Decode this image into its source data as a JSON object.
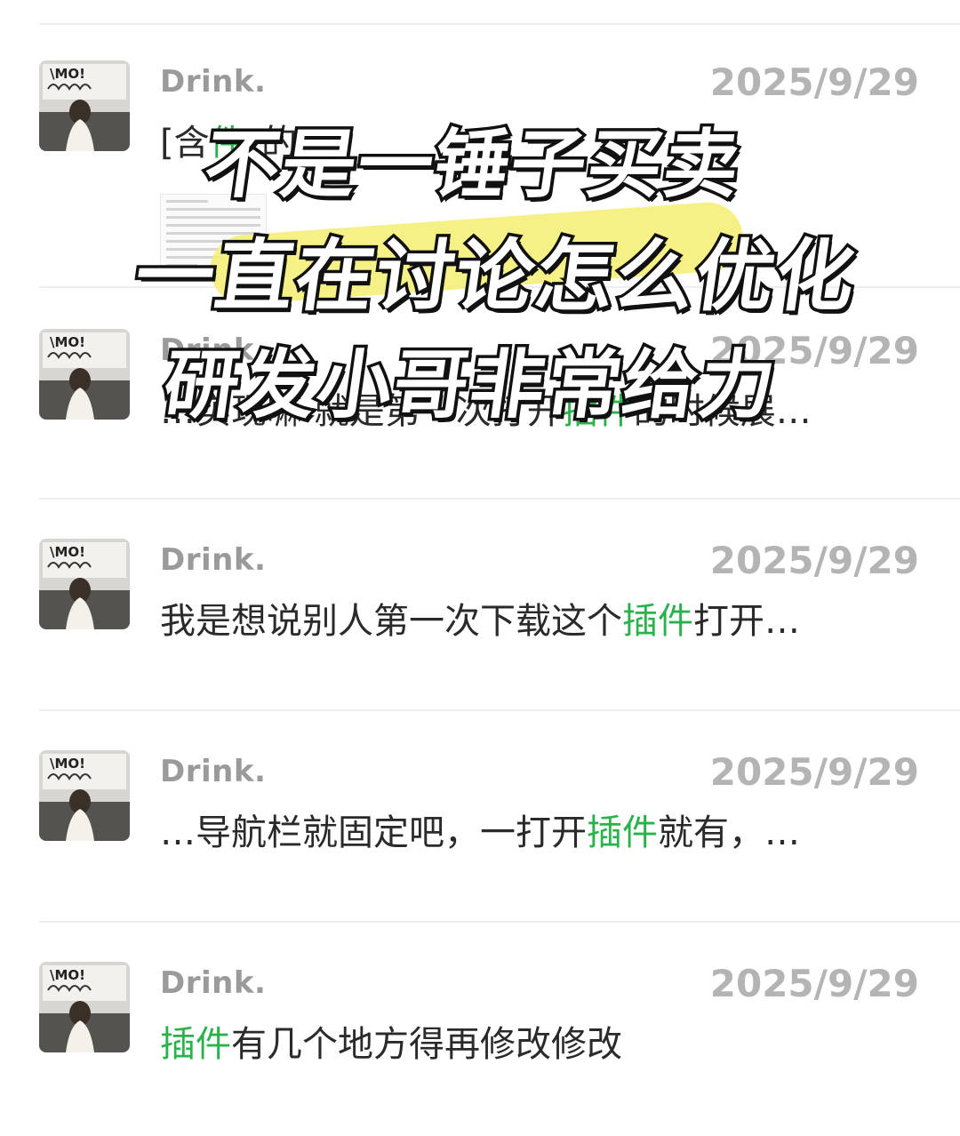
{
  "messages": [
    {
      "sender": "Drink.",
      "date": "2025/9/29",
      "parts": [
        "[含",
        "件",
        "\"的"
      ],
      "has_image": true
    },
    {
      "sender": "Drink.",
      "date": "2025/9/29",
      "parts": [
        "…实现嘛 就是第一次打开",
        "插件",
        "的时候展…"
      ],
      "has_image": false
    },
    {
      "sender": "Drink.",
      "date": "2025/9/29",
      "parts": [
        "我是想说别人第一次下载这个",
        "插件",
        "打开…"
      ],
      "has_image": false
    },
    {
      "sender": "Drink.",
      "date": "2025/9/29",
      "parts": [
        "…导航栏就固定吧，一打开",
        "插件",
        "就有，…"
      ],
      "has_image": false
    },
    {
      "sender": "Drink.",
      "date": "2025/9/29",
      "parts": [
        "",
        "插件",
        "有几个地方得再修改修改"
      ],
      "has_image": false
    }
  ],
  "avatar_text": "\\MO!",
  "overlay": {
    "line1": "不是一锤子买卖",
    "line2": "一直在讨论怎么优化",
    "line3": "研发小哥非常给力"
  },
  "colors": {
    "highlight": "#2bb24c",
    "marker": "#f4f07a"
  }
}
